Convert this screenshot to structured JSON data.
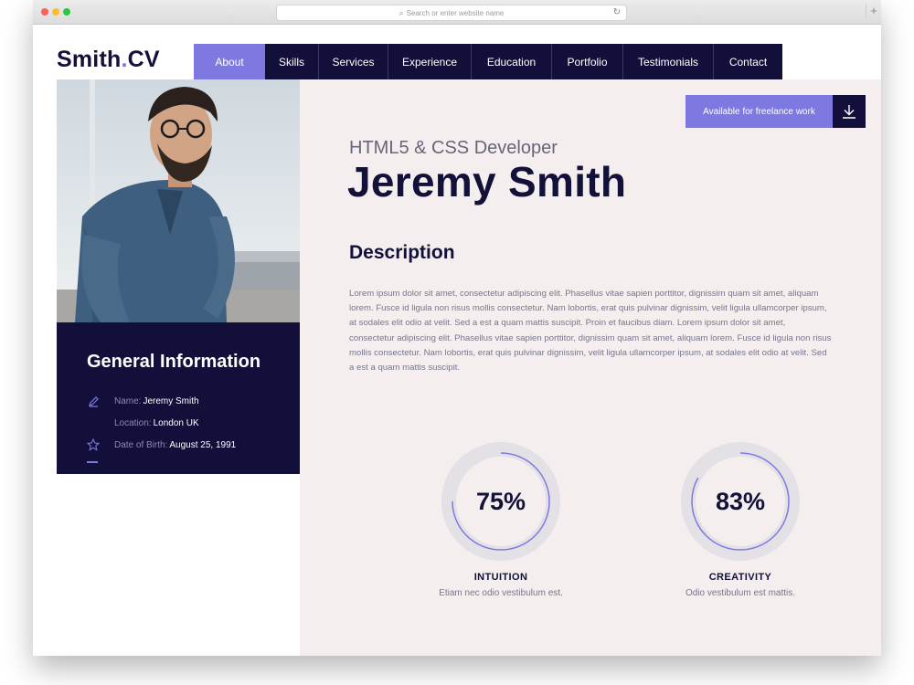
{
  "browser": {
    "url_placeholder": "Search or enter website name"
  },
  "header": {
    "logo_main": "Smith",
    "logo_dot": ".",
    "logo_suffix": "CV",
    "nav": [
      {
        "label": "About",
        "active": true
      },
      {
        "label": "Skills"
      },
      {
        "label": "Services"
      },
      {
        "label": "Experience"
      },
      {
        "label": "Education"
      },
      {
        "label": "Portfolio"
      },
      {
        "label": "Testimonials"
      },
      {
        "label": "Contact"
      }
    ]
  },
  "profile": {
    "subtitle": "HTML5 & CSS Developer",
    "name": "Jeremy Smith",
    "freelance_label": "Available for freelance work",
    "freelance_icon": "download-icon"
  },
  "general_info": {
    "title": "General Information",
    "rows": [
      {
        "icon": "pencil-icon",
        "label": "Name:",
        "value": "Jeremy Smith"
      },
      {
        "icon": "",
        "label": "Location:",
        "value": "London UK"
      },
      {
        "icon": "star-icon",
        "label": "Date of Birth:",
        "value": "August 25, 1991"
      }
    ]
  },
  "description": {
    "heading": "Description",
    "text": "Lorem ipsum dolor sit amet, consectetur adipiscing elit. Phasellus vitae sapien porttitor, dignissim quam sit amet, aliquam lorem. Fusce id ligula non risus mollis consectetur. Nam lobortis, erat quis pulvinar dignissim, velit ligula ullamcorper ipsum, at sodales elit odio at velit. Sed a est a quam mattis suscipit. Proin et faucibus diam. Lorem ipsum dolor sit amet, consectetur adipiscing elit. Phasellus vitae sapien porttitor, dignissim quam sit amet, aliquam lorem. Fusce id ligula non risus mollis consectetur. Nam lobortis, erat quis pulvinar dignissim, velit ligula ullamcorper ipsum, at sodales elit odio at velit. Sed a est a quam mattis suscipit."
  },
  "stats": [
    {
      "value_text": "75%",
      "percent": 75,
      "title": "INTUITION",
      "subtitle": "Etiam nec odio vestibulum est."
    },
    {
      "value_text": "83%",
      "percent": 83,
      "title": "CREATIVITY",
      "subtitle": "Odio vestibulum est mattis."
    }
  ],
  "colors": {
    "navy": "#120f3a",
    "accent": "#7e79e0",
    "background": "#f4efee"
  }
}
